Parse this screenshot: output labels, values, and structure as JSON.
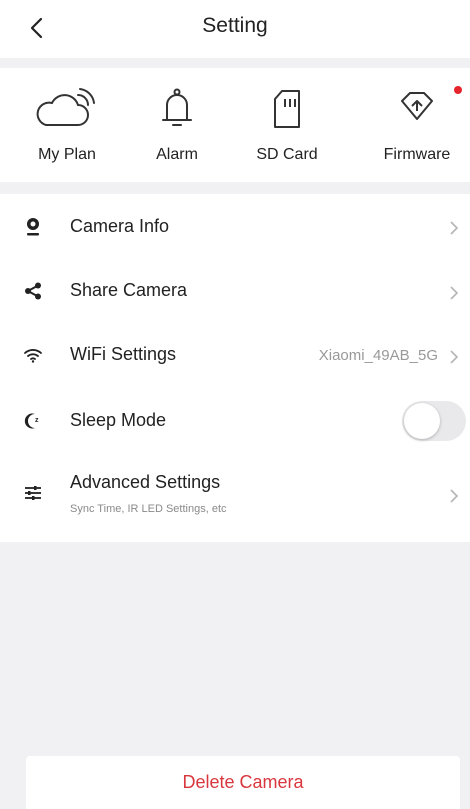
{
  "header": {
    "title": "Setting",
    "back_icon": "chevron-left-icon"
  },
  "quick_actions": [
    {
      "label": "My Plan",
      "icon": "cloud-icon"
    },
    {
      "label": "Alarm",
      "icon": "bell-icon"
    },
    {
      "label": "SD Card",
      "icon": "sd-card-icon"
    },
    {
      "label": "Firmware",
      "icon": "firmware-icon",
      "badge": true
    }
  ],
  "settings": {
    "camera_info": {
      "label": "Camera Info",
      "icon": "webcam-icon"
    },
    "share_camera": {
      "label": "Share Camera",
      "icon": "share-icon"
    },
    "wifi": {
      "label": "WiFi Settings",
      "value": "Xiaomi_49AB_5G",
      "icon": "wifi-icon"
    },
    "sleep_mode": {
      "label": "Sleep Mode",
      "enabled": false,
      "icon": "moon-icon"
    },
    "advanced": {
      "label": "Advanced  Settings",
      "subtitle": "Sync Time, IR LED Settings, etc",
      "icon": "sliders-icon"
    }
  },
  "footer": {
    "delete_label": "Delete Camera"
  },
  "colors": {
    "accent_red": "#e5242b",
    "delete_text": "#d9363e",
    "background": "#f1f1f3"
  }
}
